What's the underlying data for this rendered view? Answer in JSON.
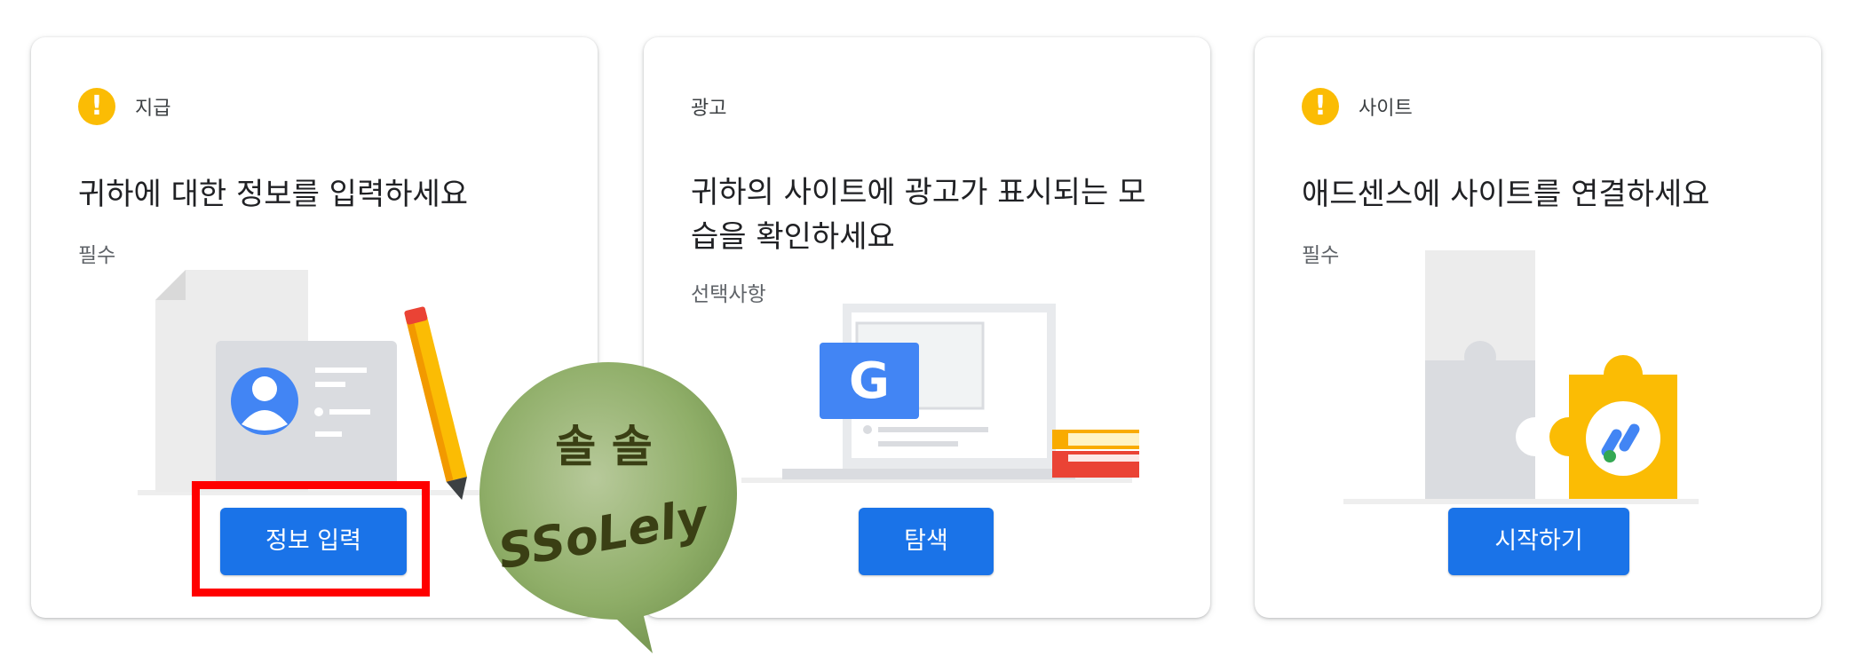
{
  "cards": [
    {
      "category": "지급",
      "title": "귀하에 대한 정보를 입력하세요",
      "subtitle": "필수",
      "button": "정보 입력",
      "icon": "warning-icon"
    },
    {
      "category": "광고",
      "title": "귀하의 사이트에 광고가 표시되는 모습을 확인하세요",
      "subtitle": "선택사항",
      "button": "탐색",
      "icon": "none"
    },
    {
      "category": "사이트",
      "title": "애드센스에 사이트를 연결하세요",
      "subtitle": "필수",
      "button": "시작하기",
      "icon": "warning-icon"
    }
  ],
  "watermark": {
    "line1": "솔 솔",
    "line2": "SSoLely"
  },
  "colors": {
    "primary": "#1a73e8",
    "warning": "#fbbc04",
    "highlight": "#ff0000"
  }
}
